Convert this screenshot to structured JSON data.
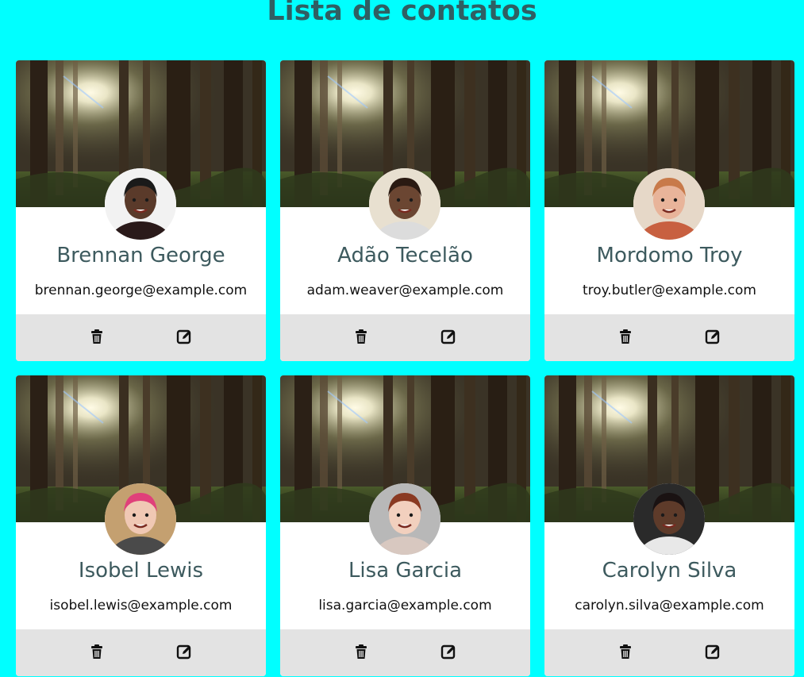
{
  "page": {
    "title": "Lista de contatos",
    "background_color": "#00ffff"
  },
  "contacts": [
    {
      "name": "Brennan George",
      "email": "brennan.george@example.com",
      "avatar": "avatar-photo"
    },
    {
      "name": "Adão Tecelão",
      "email": "adam.weaver@example.com",
      "avatar": "avatar-photo"
    },
    {
      "name": "Mordomo Troy",
      "email": "troy.butler@example.com",
      "avatar": "avatar-photo"
    },
    {
      "name": "Isobel Lewis",
      "email": "isobel.lewis@example.com",
      "avatar": "avatar-photo"
    },
    {
      "name": "Lisa Garcia",
      "email": "lisa.garcia@example.com",
      "avatar": "avatar-photo"
    },
    {
      "name": "Carolyn Silva",
      "email": "carolyn.silva@example.com",
      "avatar": "avatar-photo"
    }
  ],
  "icons": {
    "banner": "forest-banner-image",
    "delete": "trash-icon",
    "edit": "edit-icon"
  }
}
